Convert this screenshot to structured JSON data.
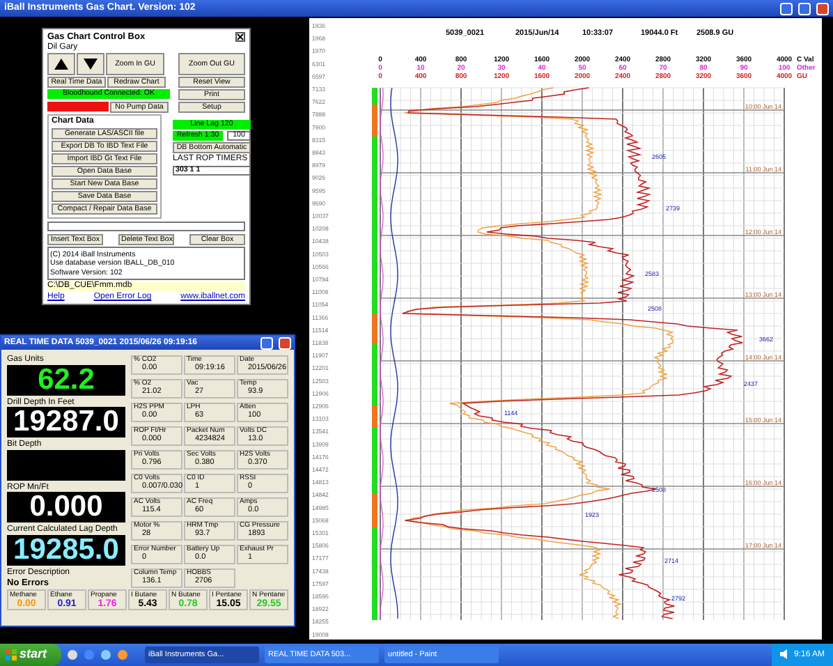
{
  "app_title": "iBall Instruments Gas Chart. Version: 102",
  "control_box": {
    "title": "Gas Chart Control Box",
    "user": "Dil Gary",
    "arrows": [
      {
        "kind": "up"
      },
      {
        "kind": "down"
      }
    ],
    "buttons": [
      {
        "label": "Zoom In GU"
      },
      {
        "label": "Zoom Out GU"
      },
      {
        "label": "Real Time Data"
      },
      {
        "label": "Redraw Chart"
      },
      {
        "label": "Reset View"
      },
      {
        "label": "Print"
      },
      {
        "label": "No Pump Data"
      },
      {
        "label": "Setup"
      }
    ],
    "statuses": [
      {
        "label": "Bloodhound Connected: OK",
        "color": "#00ee00"
      },
      {
        "color": "#ee1111"
      }
    ],
    "chart_data_group": {
      "title": "Chart Data",
      "buttons": [
        "Generate LAS/ASCII file",
        "Export DB To IBD Text File",
        "Import IBD Gt Text File",
        "Open Data Base",
        "Start New Data Base",
        "Save Data Base",
        "Compact / Repair Data Base"
      ]
    },
    "line_lag": {
      "label": "Line Lag 120",
      "color": "#00ee00"
    },
    "refresh": {
      "label": "Refresh 1:30",
      "color": "#00ee00",
      "value": "100"
    },
    "bottom_button": "DB Bottom Automatic",
    "rop_timers": {
      "label": "LAST ROP TIMERS",
      "value": "303 1 1"
    },
    "text_buttons": [
      "Insert Text Box",
      "Delete Text Box",
      "Clear Box"
    ],
    "log_lines": [
      "(C) 2014 iBall Instruments",
      "Use database version IBALL_DB_010",
      "Software Version: 102"
    ],
    "db_path": "C:\\DB_CUE\\Fmm.mdb",
    "links": [
      "Help",
      "Open Error Log",
      "www.iballnet.com"
    ]
  },
  "real_time": {
    "title": "REAL TIME DATA 5039_0021 2015/06/26 09:19:16",
    "readouts": [
      {
        "label": "Gas Units",
        "value": "62.2",
        "color": "#22ee22"
      },
      {
        "label": "Drill Depth In Feet",
        "value": "19287.0"
      },
      {
        "label": "Bit Depth"
      },
      {
        "label": "ROP Mn/Ft",
        "value": "0.000"
      },
      {
        "label": "Current Calculated Lag Depth",
        "value": "19285.0",
        "color": "#88eeff"
      }
    ],
    "error": {
      "label": "Error Description",
      "value": "No Errors"
    },
    "cells": [
      {
        "label": "% CO2",
        "value": "0.00"
      },
      {
        "label": "Time",
        "value": "09:19:16"
      },
      {
        "label": "Date",
        "value": "2015/06/26"
      },
      {
        "label": "% O2",
        "value": "21.02"
      },
      {
        "label": "Vac",
        "value": "27"
      },
      {
        "label": "Temp",
        "value": "93.9"
      },
      {
        "label": "H2S PPM",
        "value": "0.00"
      },
      {
        "label": "LPH",
        "value": "63"
      },
      {
        "label": "Atten",
        "value": "100"
      },
      {
        "label": "ROP Ft/Hr",
        "value": "0.000"
      },
      {
        "label": "Packet Num",
        "value": "4234824"
      },
      {
        "label": "Volts DC",
        "value": "13.0"
      },
      {
        "label": "Pri Volts",
        "value": "0.796"
      },
      {
        "label": "Sec Volts",
        "value": "0.380"
      },
      {
        "label": "H2S Volts",
        "value": "0.370"
      },
      {
        "label": "C0 Volts",
        "value": "0.007/0.030"
      },
      {
        "label": "C0 ID",
        "value": "1"
      },
      {
        "label": "RSSI",
        "value": "0"
      },
      {
        "label": "AC Volts",
        "value": "115.4"
      },
      {
        "label": "AC Freq",
        "value": "60"
      },
      {
        "label": "Amps",
        "value": "0.0"
      },
      {
        "label": "Motor %",
        "value": "28"
      },
      {
        "label": "HRM Tmp",
        "value": "93.7"
      },
      {
        "label": "CG Pressure",
        "value": "1893"
      },
      {
        "label": "Error Number",
        "value": "0"
      },
      {
        "label": "Battery Up",
        "value": "0.0"
      },
      {
        "label": "Exhaust Pr",
        "value": "1"
      },
      {
        "label": "Column Temp",
        "value": "136.1"
      },
      {
        "label": "HOBBS",
        "value": "2706"
      }
    ],
    "gases": [
      {
        "name": "Methane",
        "value": "0.00",
        "color": "#ff9900"
      },
      {
        "name": "Ethane",
        "value": "0.91",
        "color": "#2222cc"
      },
      {
        "name": "Propane",
        "value": "1.76",
        "color": "#ee22ee"
      },
      {
        "name": "I Butane",
        "value": "5.43",
        "color": "#000000"
      },
      {
        "name": "N Butane",
        "value": "0.78",
        "color": "#22cc22"
      },
      {
        "name": "I Pentane",
        "value": "15.05",
        "color": "#000000"
      },
      {
        "name": "N Pentane",
        "value": "29.55",
        "color": "#22cc22"
      }
    ]
  },
  "chart": {
    "header": [
      "5039_0021",
      "2015/Jun/14",
      "10:33:07",
      "19044.0 Ft",
      "2508.9 GU"
    ],
    "scales": [
      {
        "labels": [
          "0",
          "400",
          "800",
          "1200",
          "1600",
          "2000",
          "2400",
          "2800",
          "3200",
          "3600",
          "4000"
        ],
        "unit": "C Val",
        "color": "#000000"
      },
      {
        "labels": [
          "0",
          "10",
          "20",
          "30",
          "40",
          "50",
          "60",
          "70",
          "80",
          "90",
          "100"
        ],
        "unit": "Other",
        "color": "#dd22dd"
      },
      {
        "labels": [
          "0",
          "400",
          "800",
          "1200",
          "1600",
          "2000",
          "2400",
          "2800",
          "3200",
          "3600",
          "4000"
        ],
        "unit": "GU",
        "color": "#cc2222"
      }
    ],
    "depths": [
      "1936",
      "1968",
      "1970",
      "6301",
      "6597",
      "7133",
      "7622",
      "7888",
      "7900",
      "8315",
      "8843",
      "8979",
      "9026",
      "9595",
      "9690",
      "10037",
      "10208",
      "10438",
      "10503",
      "10566",
      "10784",
      "11008",
      "11054",
      "11366",
      "11514",
      "11838",
      "11907",
      "12201",
      "12503",
      "12906",
      "12906",
      "13103",
      "13541",
      "13909",
      "14176",
      "14472",
      "14813",
      "14842",
      "14985",
      "15068",
      "15301",
      "15806",
      "17177",
      "17438",
      "17597",
      "18596",
      "18922",
      "18255",
      "19008"
    ],
    "time_labels": [
      "10:00 Jun 14",
      "11:00 Jun 14",
      "12:00 Jun 14",
      "13:00 Jun 14",
      "14:00 Jun 14",
      "15:00 Jun 14",
      "16:00 Jun 14",
      "17:00 Jun 14"
    ],
    "peak_labels": [
      "2605",
      "2739",
      "2583",
      "2508",
      "3662",
      "2437",
      "1144",
      "2508",
      "1923",
      "2714",
      "2792"
    ]
  },
  "taskbar": {
    "start": "start",
    "tasks": [
      {
        "label": "iBall Instruments Ga...",
        "selected": true
      },
      {
        "label": "REAL TIME DATA 503...",
        "selected": false
      },
      {
        "label": "untitled - Paint",
        "selected": false
      }
    ],
    "clock": "9:16 AM"
  }
}
